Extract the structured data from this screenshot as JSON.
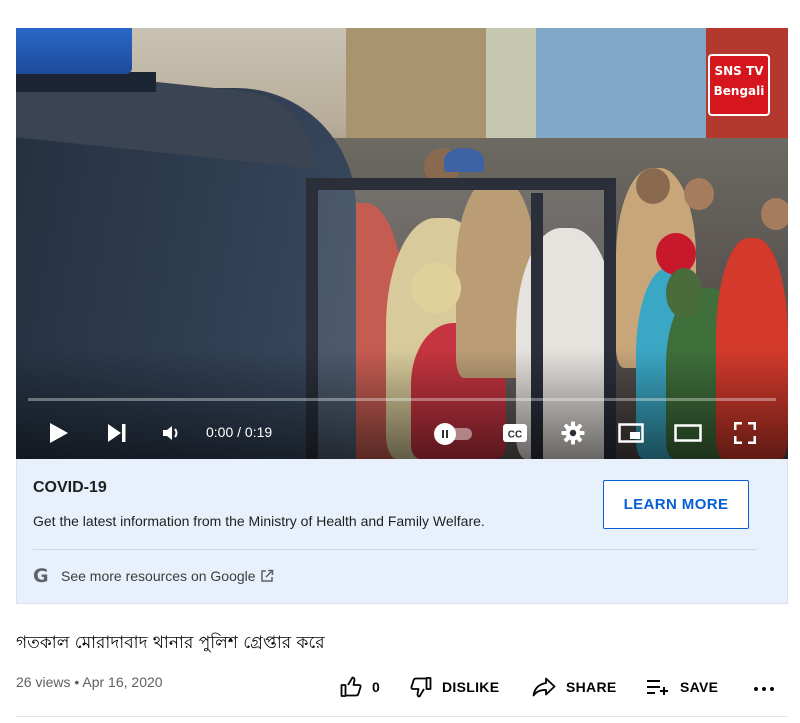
{
  "player": {
    "watermark_line1": "SNS TV",
    "watermark_line2": "Bengali",
    "time_display": "0:00 / 0:19",
    "progress": 0.0,
    "icons": {
      "play": "play-icon",
      "next": "next-icon",
      "volume": "volume-icon",
      "autoplay": "autoplay-toggle",
      "captions": "captions-icon",
      "settings": "gear-icon",
      "miniplayer": "miniplayer-icon",
      "theater": "theater-icon",
      "fullscreen": "fullscreen-icon"
    },
    "captions_label": "CC"
  },
  "covid": {
    "title": "COVID-19",
    "description": "Get the latest information from the Ministry of Health and Family Welfare.",
    "button_label": "LEARN MORE",
    "more_resources": "See more resources on Google"
  },
  "video": {
    "title": "গতকাল মোরাদাবাদ থানার পুলিশ গ্রেপ্তার করে",
    "views_date": "26 views • Apr 16, 2020",
    "like_count": "0",
    "dislike_label": "DISLIKE",
    "share_label": "SHARE",
    "save_label": "SAVE"
  },
  "colors": {
    "accent_blue": "#065fd4",
    "info_panel_bg": "#e8f1fb",
    "watermark_red": "#d5171d"
  }
}
